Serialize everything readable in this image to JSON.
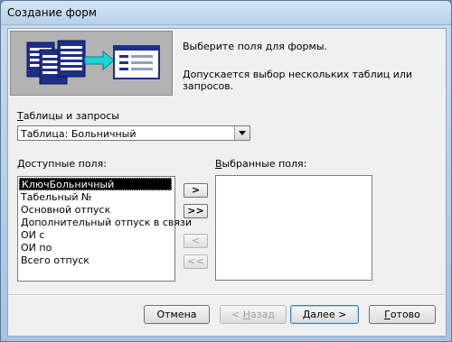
{
  "window": {
    "title": "Создание форм"
  },
  "intro": {
    "line1": "Выберите поля для формы.",
    "line2": "Допускается выбор нескольких таблиц или запросов."
  },
  "source": {
    "label_prefix": "Т",
    "label_rest": "аблицы и запросы",
    "selected": "Таблица: Больничный"
  },
  "available": {
    "label_prefix": "Д",
    "label_rest": "оступные поля:",
    "items": [
      "КлючБольничный",
      "Табельный №",
      "Основной отпуск",
      "Дополнительный отпуск в связи",
      "ОИ с",
      "ОИ по",
      "Всего отпуск"
    ]
  },
  "selected_fields": {
    "label_prefix": "В",
    "label_rest": "ыбранные поля:",
    "items": []
  },
  "move_buttons": {
    "add_one": ">",
    "add_all": ">>",
    "remove_one": "<",
    "remove_all": "<<"
  },
  "footer": {
    "cancel": "Отмена",
    "back_prefix": "< ",
    "back_underline": "Н",
    "back_rest": "азад",
    "next_prefix": "",
    "next_underline": "Д",
    "next_rest": "алее >",
    "finish_prefix": "",
    "finish_underline": "Г",
    "finish_rest": "отово"
  },
  "colors": {
    "desktop": "#6d8cad",
    "frame": "#b6cfe6",
    "client": "#f0f0f0",
    "selection": "#000000"
  }
}
